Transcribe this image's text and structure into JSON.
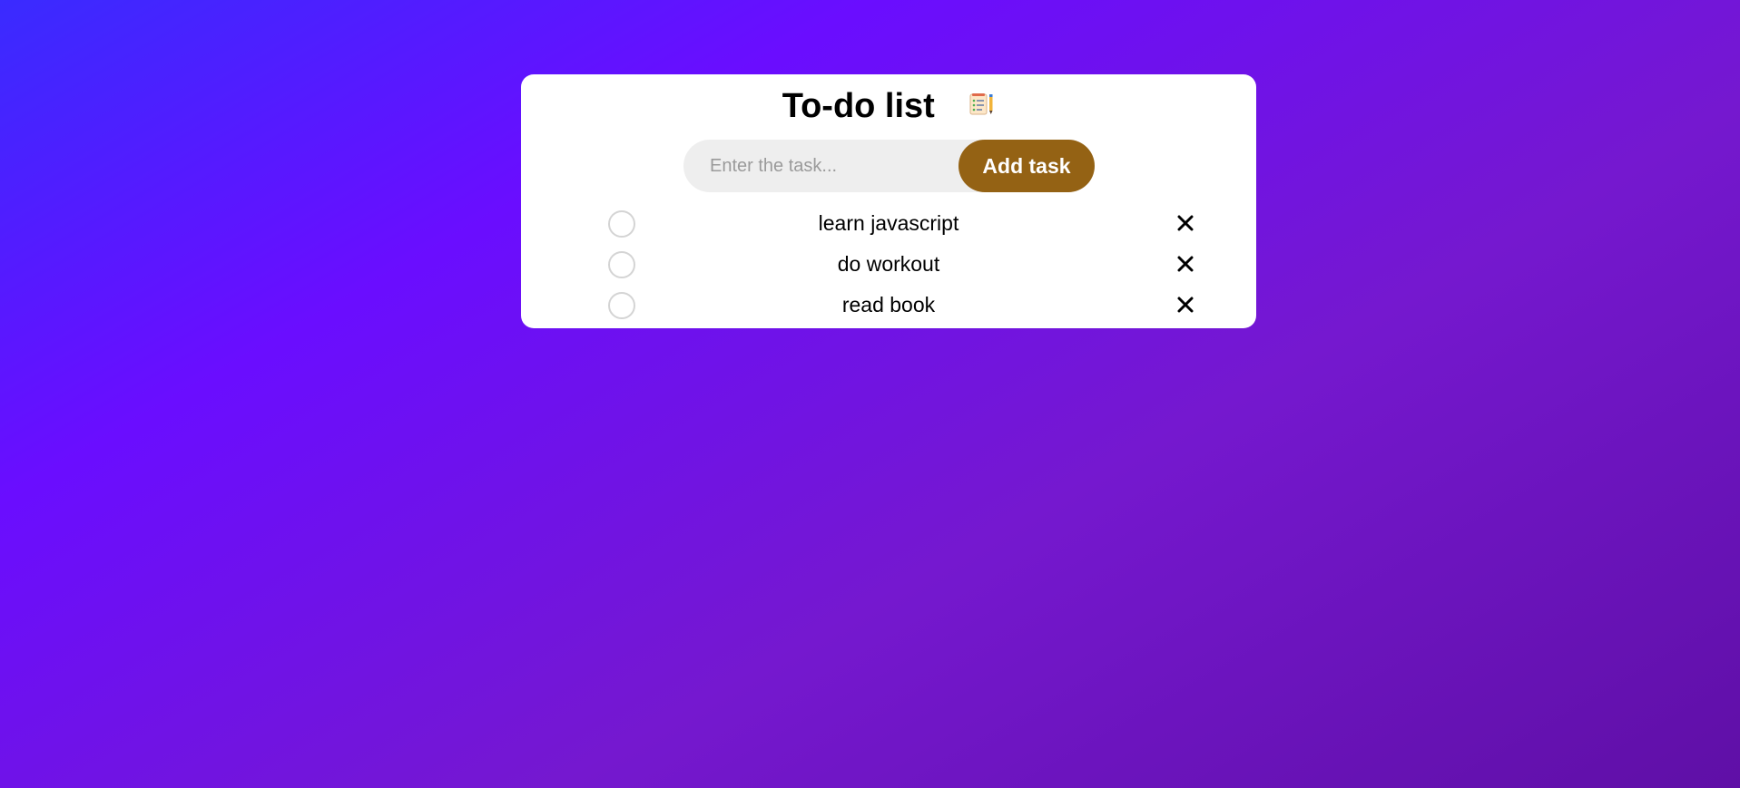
{
  "app": {
    "title": "To-do list",
    "title_icon": "checklist-notepad-icon"
  },
  "input": {
    "placeholder": "Enter the task...",
    "value": ""
  },
  "add_button": {
    "label": "Add task"
  },
  "tasks": [
    {
      "text": "learn javascript",
      "checked": false
    },
    {
      "text": "do workout",
      "checked": false
    },
    {
      "text": "read book",
      "checked": false
    }
  ],
  "icons": {
    "check": "unchecked-circle-icon",
    "remove": "close-icon"
  },
  "colors": {
    "background_start": "#3a2bff",
    "background_mid": "#6a0dff",
    "background_end": "#5f0fa6",
    "card": "#ffffff",
    "input_bg": "#eeeeee",
    "button_bg": "#946214",
    "button_text": "#ffffff",
    "checkbox_border": "#d4d4d4"
  }
}
